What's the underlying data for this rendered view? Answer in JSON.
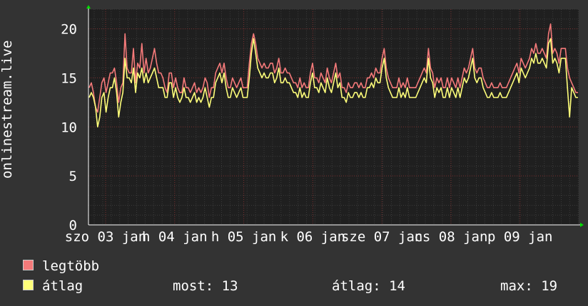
{
  "chart_data": {
    "type": "line",
    "ylabel": "onlinestream.live",
    "ylim": [
      0,
      22
    ],
    "y_ticks": [
      0,
      5,
      10,
      15,
      20
    ],
    "x_tick_labels": [
      "szo 03 jan",
      "h 04 jan",
      "h 05 jan",
      "k 06 jan",
      "sze 07 jan",
      "cs 08 jan",
      "p 09 jan"
    ],
    "x_label_texts": [
      {
        "label": "szo 03 jan",
        "x": 0.0
      },
      {
        "label": "h 04 jan",
        "x": 1.0
      },
      {
        "label": "h 05 jan",
        "x": 2.0
      },
      {
        "label": "k 06 jan",
        "x": 3.0
      },
      {
        "label": "sze 07 jan",
        "x": 4.0
      },
      {
        "label": "cs 08 jan",
        "x": 5.0
      },
      {
        "label": "p 09 jan",
        "x": 6.0
      }
    ],
    "grid": true,
    "legend_position": "bottom",
    "series": [
      {
        "name": "legtöbb",
        "color": "#f57a7a",
        "values": [
          14,
          14.5,
          13.5,
          12,
          11.5,
          13,
          14.5,
          15,
          13.5,
          14.5,
          15.5,
          15.5,
          16,
          14.5,
          12.5,
          14,
          14.5,
          19.5,
          16,
          15.5,
          15.5,
          18,
          14.5,
          16.5,
          16,
          18.5,
          15.5,
          17,
          15.5,
          16,
          17,
          18,
          16.5,
          15.5,
          15.5,
          15,
          14,
          13.5,
          15.5,
          15.5,
          14,
          15,
          14,
          13.5,
          13.5,
          15,
          14,
          14,
          13.5,
          14,
          14.5,
          13.5,
          14,
          13.5,
          14,
          15,
          14.5,
          13,
          14,
          14,
          15.5,
          16,
          16.5,
          15.5,
          16.5,
          15,
          14,
          14,
          15,
          14.5,
          14,
          14.5,
          15,
          14,
          14,
          14,
          16.5,
          18.5,
          19.5,
          18.5,
          17,
          16.5,
          16,
          16.5,
          16,
          16,
          16.5,
          16.5,
          15.5,
          16,
          17,
          15.5,
          15.5,
          16,
          15.5,
          15.5,
          15,
          14.5,
          14.5,
          14,
          15,
          14,
          14.5,
          14,
          14,
          15.5,
          16.5,
          15,
          15,
          14.5,
          15.5,
          15,
          14.5,
          16,
          15,
          14.5,
          15.5,
          16.5,
          15,
          15.5,
          14,
          14,
          13.5,
          14.5,
          14,
          14,
          14.5,
          14.5,
          14,
          14.5,
          14,
          14,
          15,
          15,
          15.5,
          15,
          16,
          15.5,
          15.5,
          17,
          18,
          16,
          15,
          14.5,
          14,
          14,
          14,
          15,
          14,
          14.5,
          14,
          15,
          14,
          14,
          14,
          14,
          14.5,
          15,
          15.5,
          16,
          15.5,
          18,
          16,
          15.5,
          14,
          15,
          14.5,
          15,
          14,
          14,
          15,
          14,
          15,
          14.5,
          14,
          15,
          14,
          15,
          16,
          15.5,
          16,
          17,
          18,
          16,
          15.5,
          16,
          16,
          15,
          14.5,
          14,
          14,
          14.5,
          14,
          14,
          14,
          14.5,
          14,
          14,
          14,
          14.5,
          15,
          15.5,
          16,
          16.5,
          15.5,
          17,
          16.5,
          16,
          16.5,
          17,
          18,
          17.5,
          18.5,
          17.5,
          17.5,
          18,
          17.5,
          17,
          19.5,
          20.5,
          17.5,
          18,
          17.5,
          16.5,
          18,
          18,
          18,
          16,
          15,
          14.5,
          14,
          13.5,
          13.5
        ]
      },
      {
        "name": "átlag",
        "color": "#ffff7a",
        "values": [
          13,
          13.5,
          13,
          12,
          10,
          11,
          13,
          13.5,
          11.5,
          13,
          14,
          14,
          15,
          13.5,
          11,
          12.5,
          13.5,
          17,
          15,
          15,
          14.5,
          16,
          13.5,
          15.5,
          15,
          16,
          14.5,
          15.5,
          14.5,
          15,
          15.5,
          16,
          15,
          14,
          14,
          14,
          13,
          13,
          14.5,
          14.5,
          13,
          14,
          13,
          12.5,
          13,
          14,
          13,
          13,
          12.5,
          13,
          13.5,
          12.5,
          13,
          12.5,
          13,
          14,
          13,
          12,
          13,
          13,
          14.5,
          15,
          15.5,
          14.5,
          15.5,
          14,
          13,
          13,
          14,
          13.5,
          13,
          13.5,
          14,
          13,
          13,
          13,
          15,
          17.5,
          19,
          17.5,
          16,
          15.5,
          15,
          15.5,
          15,
          15,
          15.5,
          15.5,
          14.5,
          15,
          16,
          14.5,
          14.5,
          15,
          14.5,
          14.5,
          14,
          13.5,
          13.5,
          13,
          14,
          13,
          13.5,
          13,
          13,
          14.5,
          15.5,
          14,
          14,
          13.5,
          14.5,
          14,
          13.5,
          15,
          14,
          13.5,
          14.5,
          15.5,
          14,
          14.5,
          13,
          13,
          12.5,
          13.5,
          13,
          13,
          13.5,
          13.5,
          13,
          13.5,
          13,
          13,
          14,
          14,
          14.5,
          14,
          15,
          14.5,
          14.5,
          16,
          17,
          15,
          14,
          13.5,
          13,
          13,
          13,
          14,
          13,
          13.5,
          13,
          14,
          13,
          13,
          13,
          13,
          13.5,
          14,
          14.5,
          15,
          14.5,
          17,
          15,
          14.5,
          13,
          14,
          13.5,
          14,
          13,
          13,
          14,
          13,
          14,
          13.5,
          13,
          14,
          13,
          14,
          15,
          14.5,
          15,
          16,
          17,
          15,
          14.5,
          15,
          15,
          14,
          13.5,
          13,
          13,
          13.5,
          13,
          13,
          13,
          13.5,
          13,
          13,
          13,
          13.5,
          14,
          14.5,
          15,
          15.5,
          14.5,
          16,
          15.5,
          15,
          15.5,
          16,
          17,
          16.5,
          17.5,
          16.5,
          16.5,
          17,
          16.5,
          16,
          18.5,
          19,
          16.5,
          17,
          16.5,
          15.5,
          17,
          17,
          17,
          14,
          11,
          14,
          13.5,
          13,
          13
        ]
      }
    ]
  },
  "legend": {
    "items": [
      {
        "label": "legtöbb",
        "color": "#f57a7a"
      },
      {
        "label": "átlag",
        "color": "#ffff7a"
      }
    ],
    "stats": {
      "now": "most: 13",
      "avg": "átlag: 14",
      "max": "max: 19"
    }
  }
}
